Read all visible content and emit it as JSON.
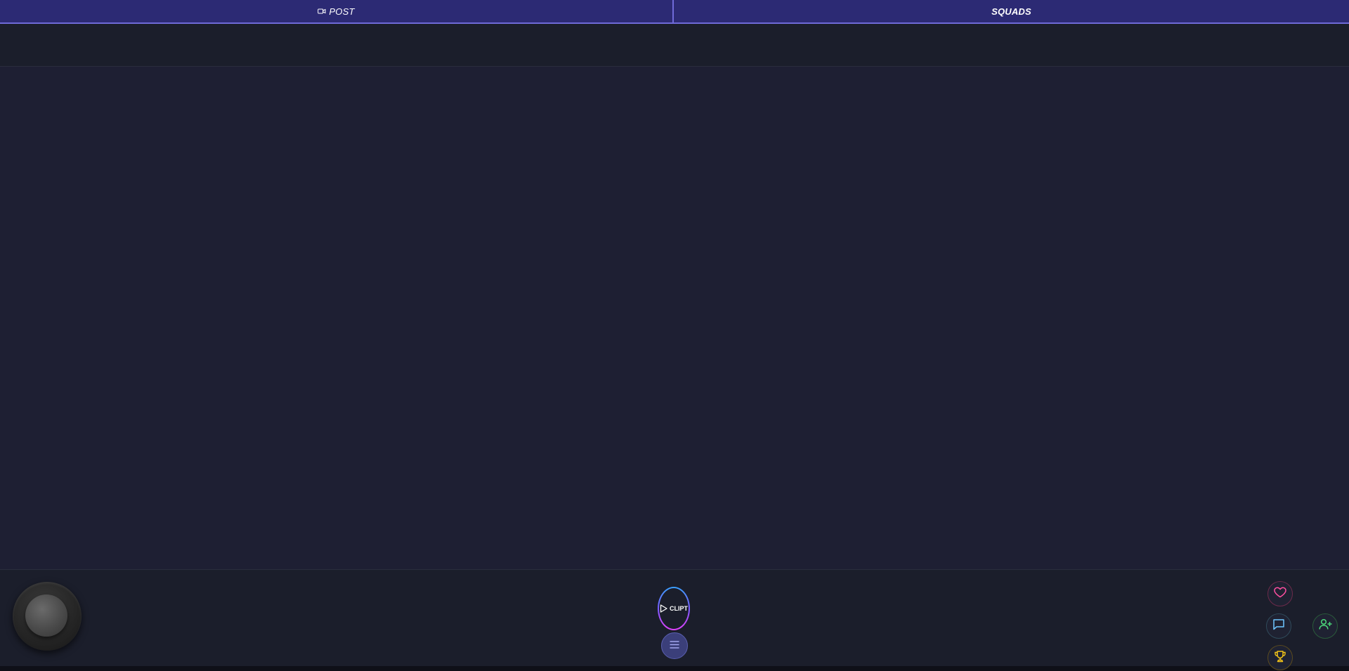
{
  "tabs": {
    "post_label": "POST",
    "squads_label": "SQUADS"
  },
  "controls": {
    "clipt_label": "CLIPT"
  },
  "icons": {
    "post": "video-camera-icon",
    "clipt": "play-icon",
    "menu": "hamburger-menu-icon",
    "like": "heart-icon",
    "comment": "chat-bubble-icon",
    "trophy": "trophy-icon",
    "add_user": "user-plus-icon"
  },
  "colors": {
    "topbar": "#2c2a74",
    "accent_border": "#6f6ad8",
    "background": "#1e1f33",
    "panel": "#1b1e2b",
    "like": "#ff4fa0",
    "comment": "#6ec6ff",
    "trophy": "#f5c518",
    "add_user": "#4cd97b",
    "menu": "#3b3f7a"
  }
}
